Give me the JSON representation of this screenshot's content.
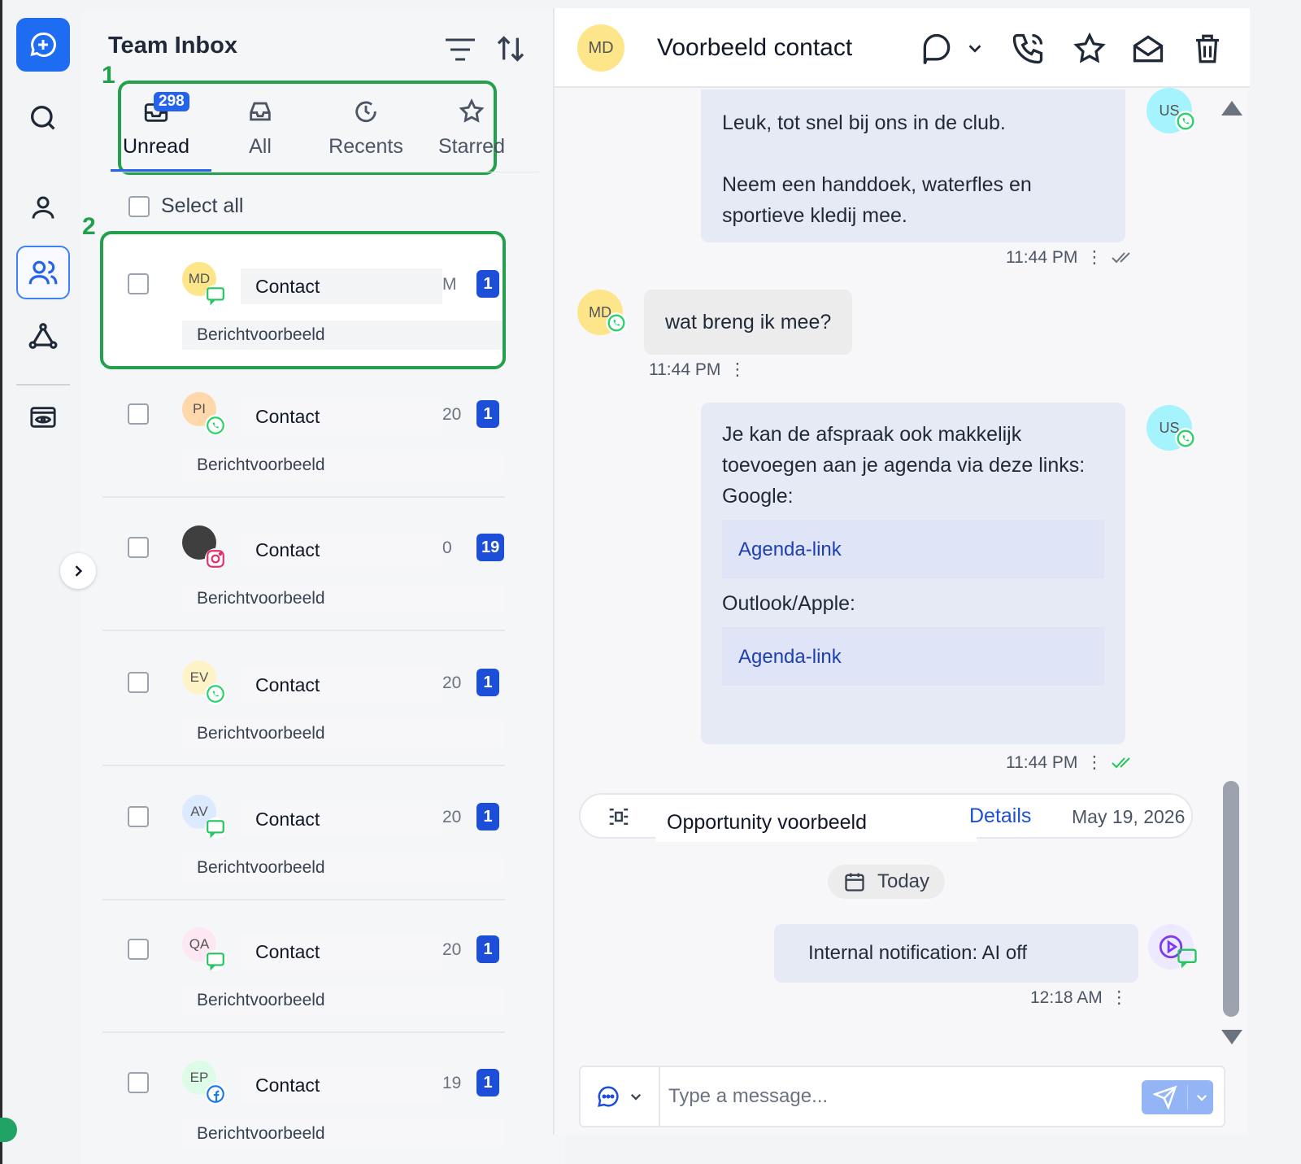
{
  "rail": {
    "items": [
      "new-conversation",
      "search",
      "contacts",
      "team-inbox",
      "workflows",
      "preview"
    ]
  },
  "inbox": {
    "title": "Team Inbox",
    "annotation_1": "1",
    "annotation_2": "2",
    "unread_badge": "298",
    "tabs": [
      {
        "label": "Unread",
        "icon": "inbox-tray-icon",
        "active": true
      },
      {
        "label": "All",
        "icon": "inbox-icon"
      },
      {
        "label": "Recents",
        "icon": "clock-icon"
      },
      {
        "label": "Starred",
        "icon": "star-icon"
      }
    ],
    "select_all": "Select all",
    "conversations": [
      {
        "initials": "MD",
        "name": "Contact",
        "date": "M",
        "count": "1",
        "preview": "Berichtvoorbeeld",
        "channel": "sms",
        "avatar_bg": "#fde68a"
      },
      {
        "initials": "PI",
        "name": "Contact",
        "date": "20",
        "count": "1",
        "preview": "Berichtvoorbeeld",
        "channel": "whatsapp",
        "avatar_bg": "#fed7aa"
      },
      {
        "initials": "",
        "name": "Contact",
        "date": "0",
        "count": "19",
        "preview": "Berichtvoorbeeld",
        "channel": "instagram",
        "avatar_bg": "#3f3f3f"
      },
      {
        "initials": "EV",
        "name": "Contact",
        "date": "20",
        "count": "1",
        "preview": "Berichtvoorbeeld",
        "channel": "whatsapp",
        "avatar_bg": "#fef3c7"
      },
      {
        "initials": "AV",
        "name": "Contact",
        "date": "20",
        "count": "1",
        "preview": "Berichtvoorbeeld",
        "channel": "sms",
        "avatar_bg": "#dbeafe"
      },
      {
        "initials": "QA",
        "name": "Contact",
        "date": "20",
        "count": "1",
        "preview": "Berichtvoorbeeld",
        "channel": "sms",
        "avatar_bg": "#fce7f3"
      },
      {
        "initials": "EP",
        "name": "Contact",
        "date": "19",
        "count": "1",
        "preview": "Berichtvoorbeeld",
        "channel": "facebook",
        "avatar_bg": "#dcfce7"
      }
    ]
  },
  "chat": {
    "contact_initials": "MD",
    "contact_name": "Voorbeeld contact",
    "messages": {
      "m1_line1": "Leuk, tot snel bij ons in de club.",
      "m1_line2": "Neem een handdoek, waterfles en sportieve kledij mee.",
      "m1_time": "11:44 PM",
      "m2_text": "wat breng ik mee?",
      "m2_time": "11:44 PM",
      "m3_text": "Je kan de afspraak ook makkelijk toevoegen aan je agenda via deze links:",
      "m3_google": "Google:",
      "m3_link1": "Agenda-link",
      "m3_outlook": "Outlook/Apple:",
      "m3_link2": "Agenda-link",
      "m3_time": "11:44 PM",
      "user_initials": "US"
    },
    "opportunity": {
      "label": "Opportunity voorbeeld",
      "details": "Details",
      "date": "May 19, 2026"
    },
    "today": "Today",
    "note": {
      "text": "Internal notification: AI off",
      "time": "12:18 AM"
    },
    "composer": {
      "placeholder": "Type a message..."
    }
  },
  "colors": {
    "accent": "#2563eb",
    "annotation": "#22a04b",
    "whatsapp": "#25d366"
  }
}
